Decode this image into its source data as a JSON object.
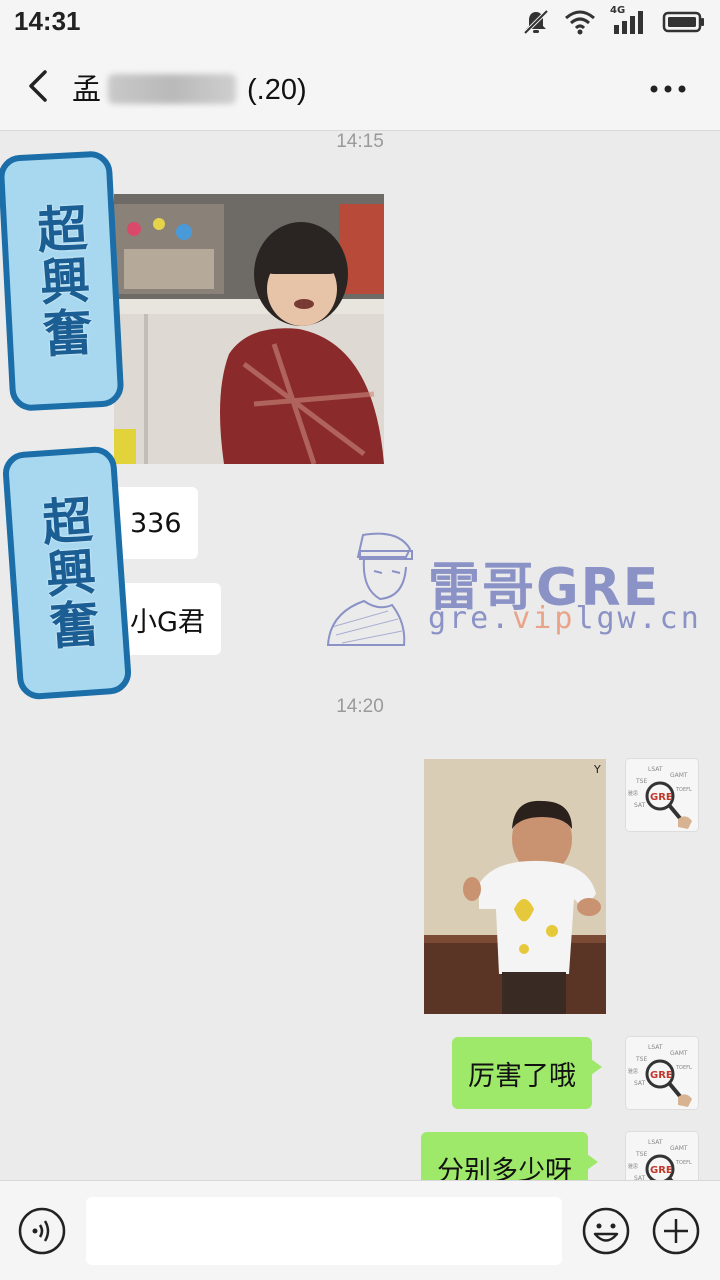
{
  "status_bar": {
    "time": "14:31",
    "network_label": "4G"
  },
  "header": {
    "title_visible_start": "孟",
    "title_visible_end": "(.20)"
  },
  "messages": {
    "timestamp_1": "14:15",
    "incoming_text_1": "336",
    "incoming_text_2": "小G君",
    "timestamp_2": "14:20",
    "outgoing_text_1": "厉害了哦",
    "outgoing_text_2": "分别多少呀"
  },
  "stickers": {
    "text": "超興奮"
  },
  "watermark": {
    "title": "雷哥GRE",
    "url_part_1": "gre.",
    "url_highlight": "vip",
    "url_part_2": "lgw.cn"
  },
  "avatar": {
    "tags": [
      "LSAT",
      "GAMT",
      "TSE",
      "TOEFL",
      "雅思",
      "SAT",
      "GRE"
    ]
  },
  "input_bar": {
    "placeholder": ""
  },
  "icons": [
    "mute-icon",
    "wifi-icon",
    "signal-icon",
    "battery-icon",
    "back-icon",
    "more-icon",
    "voice-icon",
    "emoji-icon",
    "plus-icon"
  ],
  "colors": {
    "background": "#ebebeb",
    "bar": "#f5f5f5",
    "outgoing_bubble": "#9ee86a",
    "incoming_bubble": "#ffffff",
    "sticker_fill": "#a8d8f0",
    "sticker_border": "#1b6ea8"
  }
}
